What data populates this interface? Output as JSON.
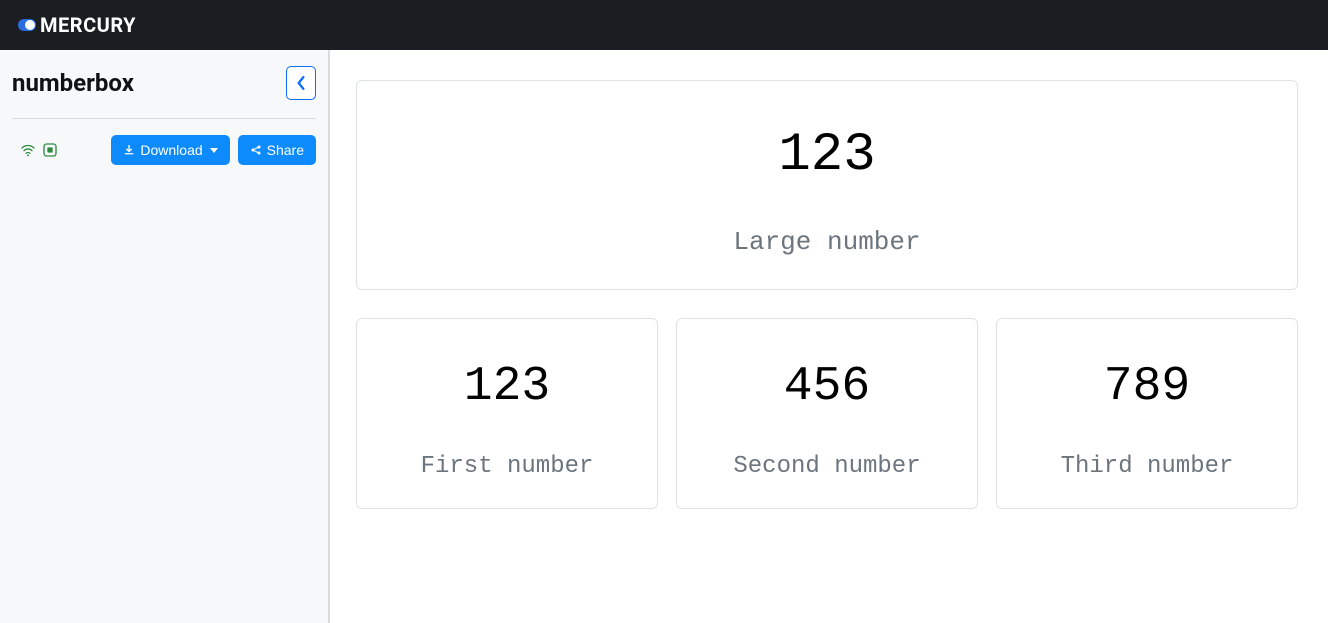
{
  "brand": "MERCURY",
  "sidebar": {
    "title": "numberbox",
    "download_label": "Download",
    "share_label": "Share"
  },
  "cards": {
    "large": {
      "value": "123",
      "label": "Large number"
    },
    "small": [
      {
        "value": "123",
        "label": "First number"
      },
      {
        "value": "456",
        "label": "Second number"
      },
      {
        "value": "789",
        "label": "Third number"
      }
    ]
  }
}
